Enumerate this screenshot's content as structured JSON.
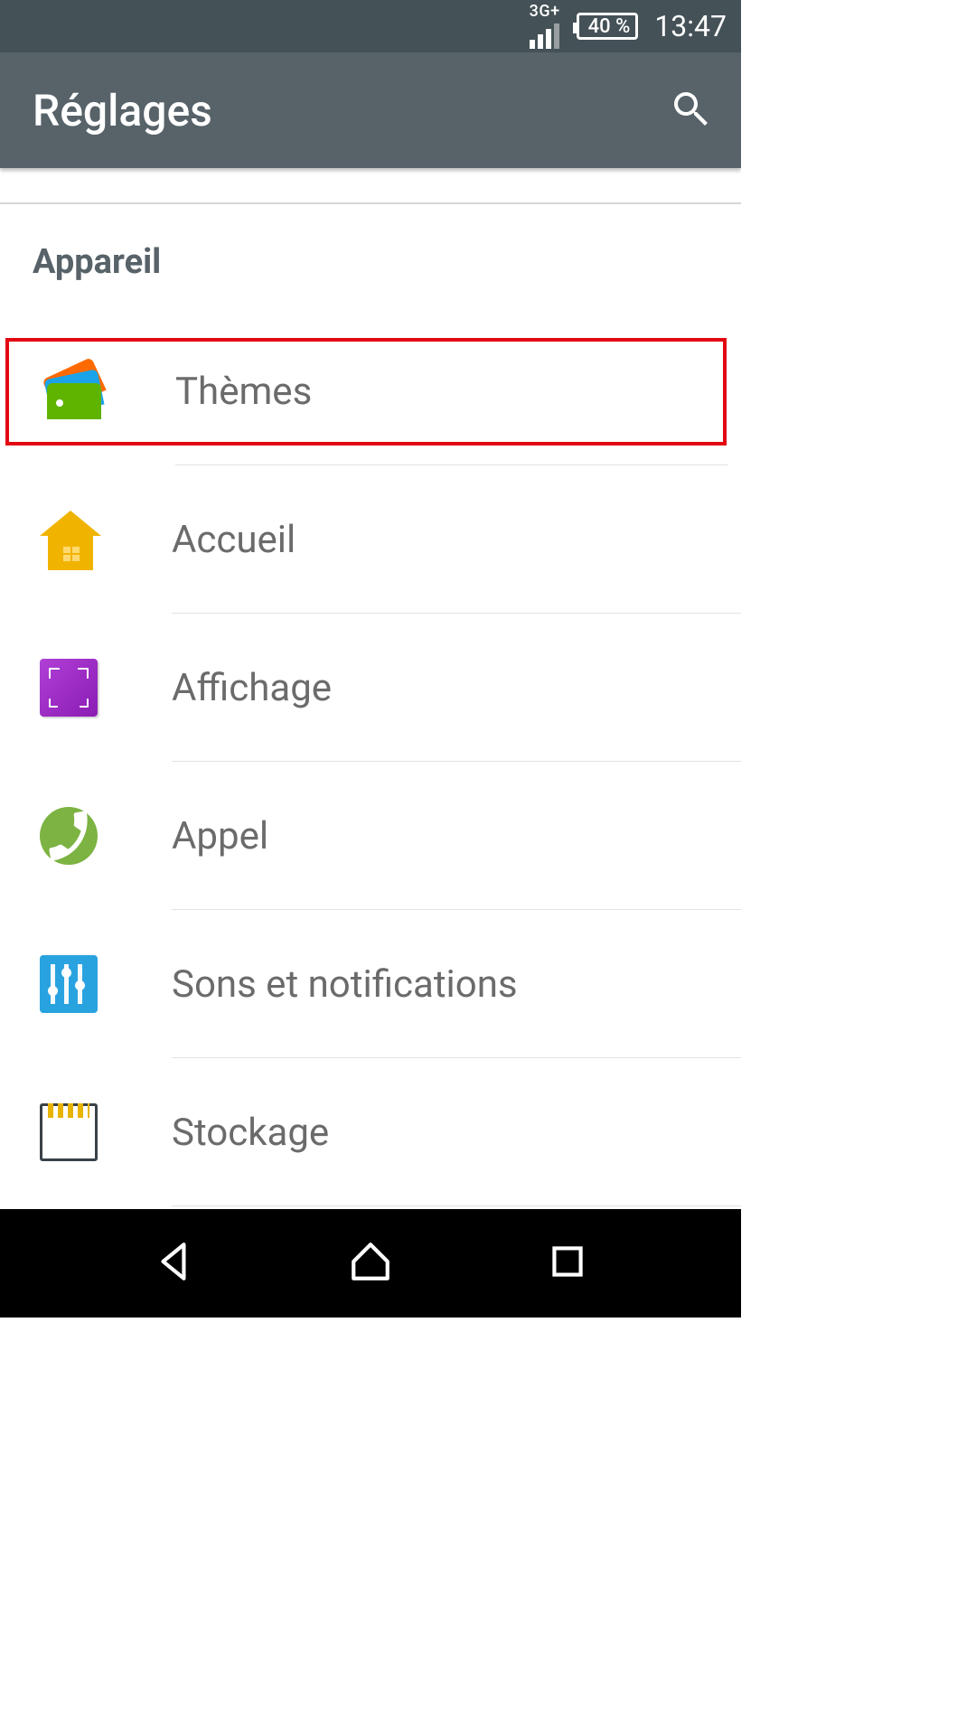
{
  "status": {
    "network_label": "3G+",
    "battery_text": "40 %",
    "time": "13:47"
  },
  "appbar": {
    "title": "Réglages"
  },
  "section": {
    "heading": "Appareil"
  },
  "items": {
    "themes": {
      "label": "Thèmes"
    },
    "home": {
      "label": "Accueil"
    },
    "display": {
      "label": "Affichage"
    },
    "call": {
      "label": "Appel"
    },
    "sounds": {
      "label": "Sons et notifications"
    },
    "storage": {
      "label": "Stockage"
    }
  }
}
